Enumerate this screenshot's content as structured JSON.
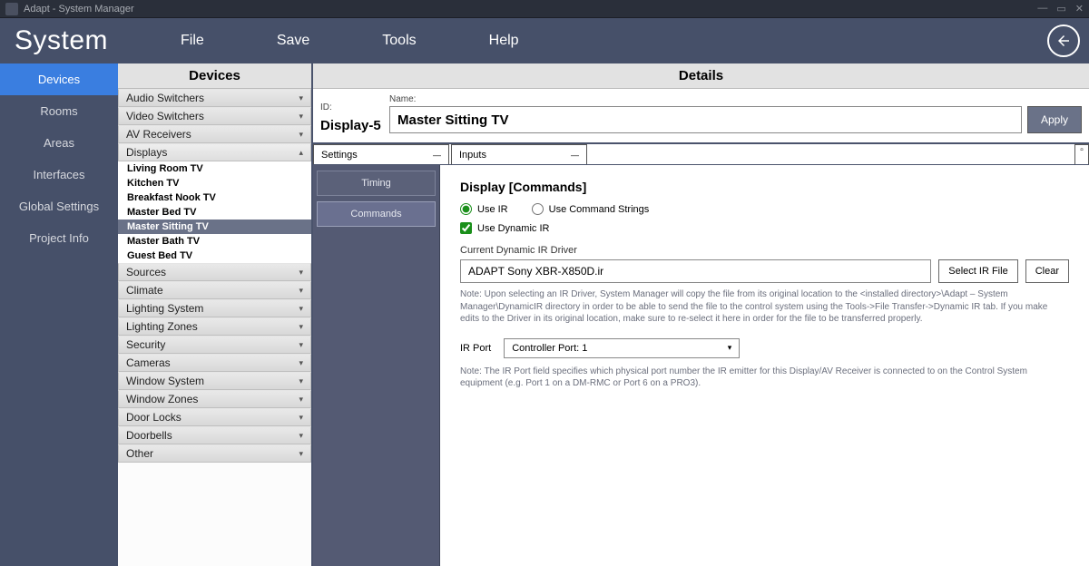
{
  "window": {
    "title": "Adapt - System Manager"
  },
  "app_title": "System",
  "menu": [
    "File",
    "Save",
    "Tools",
    "Help"
  ],
  "left_nav": {
    "items": [
      "Devices",
      "Rooms",
      "Areas",
      "Interfaces",
      "Global Settings",
      "Project Info"
    ],
    "active": 0
  },
  "devices_col": {
    "header": "Devices",
    "categories": [
      {
        "label": "Audio Switchers",
        "expanded": false
      },
      {
        "label": "Video Switchers",
        "expanded": false
      },
      {
        "label": "AV Receivers",
        "expanded": false
      },
      {
        "label": "Displays",
        "expanded": true,
        "items": [
          "Living Room TV",
          "Kitchen TV",
          "Breakfast Nook TV",
          "Master Bed TV",
          "Master Sitting TV",
          "Master Bath TV",
          "Guest Bed TV"
        ],
        "selected": 4
      },
      {
        "label": "Sources",
        "expanded": false
      },
      {
        "label": "Climate",
        "expanded": false
      },
      {
        "label": "Lighting System",
        "expanded": false
      },
      {
        "label": "Lighting Zones",
        "expanded": false
      },
      {
        "label": "Security",
        "expanded": false
      },
      {
        "label": "Cameras",
        "expanded": false
      },
      {
        "label": "Window System",
        "expanded": false
      },
      {
        "label": "Window Zones",
        "expanded": false
      },
      {
        "label": "Door Locks",
        "expanded": false
      },
      {
        "label": "Doorbells",
        "expanded": false
      },
      {
        "label": "Other",
        "expanded": false
      }
    ]
  },
  "details": {
    "header": "Details",
    "id_label": "ID:",
    "id_value": "Display-5",
    "name_label": "Name:",
    "name_value": "Master Sitting TV",
    "apply_label": "Apply",
    "tabs": [
      "Settings",
      "Inputs"
    ],
    "sub_tabs": {
      "items": [
        "Timing",
        "Commands"
      ],
      "active": 1
    },
    "commands": {
      "title": "Display [Commands]",
      "radio_use_ir": "Use IR",
      "radio_use_cmd": "Use Command Strings",
      "radio_selected": "ir",
      "chk_dynamic_label": "Use Dynamic IR",
      "chk_dynamic_checked": true,
      "driver_label": "Current Dynamic IR Driver",
      "driver_value": "ADAPT Sony XBR-X850D.ir",
      "select_file_label": "Select IR File",
      "clear_label": "Clear",
      "note1": "Note: Upon selecting an IR Driver, System Manager will copy the file from its original location to the <installed directory>\\Adapt – System Manager\\DynamicIR directory in order to be able to send the file to the control system using the Tools->File Transfer->Dynamic IR tab. If you make edits to the Driver in its original location, make sure to re-select it here in order for the file to be transferred properly.",
      "ir_port_label": "IR Port",
      "ir_port_value": "Controller Port: 1",
      "note2": "Note: The IR Port field specifies which physical port number the IR emitter for this Display/AV Receiver is connected to on the Control System equipment (e.g. Port 1 on a DM-RMC or Port 6 on a PRO3)."
    }
  }
}
